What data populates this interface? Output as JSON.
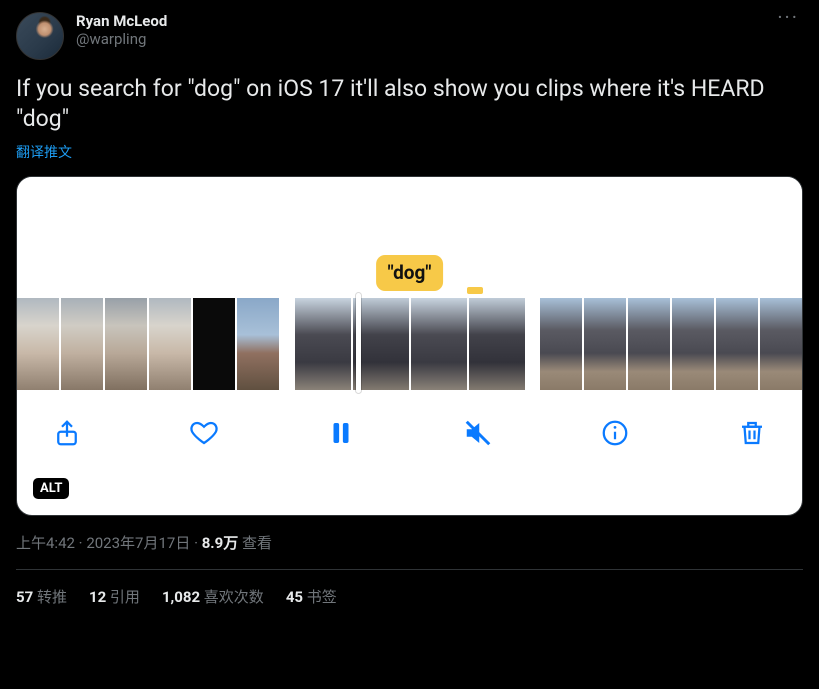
{
  "user": {
    "displayName": "Ryan McLeod",
    "handle": "@warpling"
  },
  "tweet": {
    "text": "If you search for \"dog\" on iOS 17 it'll also show you clips where it's HEARD \"dog\"",
    "translateLabel": "翻译推文"
  },
  "media": {
    "captionPill": "\"dog\"",
    "altBadge": "ALT",
    "toolbar": {
      "share": "share",
      "like": "like",
      "pause": "pause",
      "mute": "mute",
      "info": "info",
      "trash": "trash"
    }
  },
  "meta": {
    "time": "上午4:42",
    "date": "2023年7月17日",
    "viewsCount": "8.9万",
    "viewsLabel": "查看"
  },
  "stats": {
    "retweets": {
      "count": "57",
      "label": "转推"
    },
    "quotes": {
      "count": "12",
      "label": "引用"
    },
    "likes": {
      "count": "1,082",
      "label": "喜欢次数"
    },
    "bookmarks": {
      "count": "45",
      "label": "书签"
    }
  }
}
